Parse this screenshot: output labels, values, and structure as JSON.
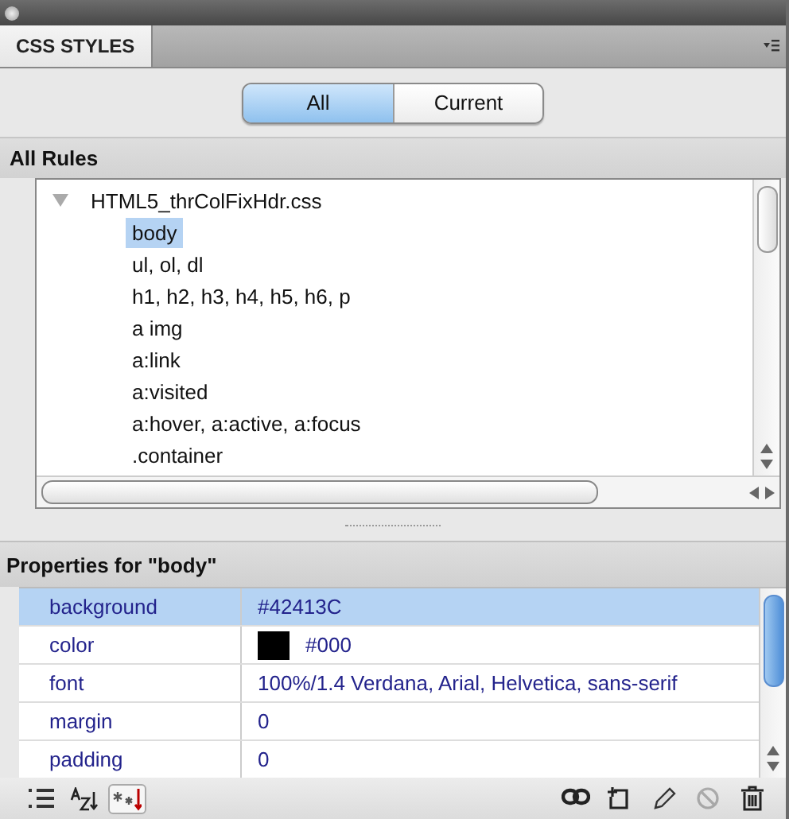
{
  "panel_tab": {
    "label": "CSS STYLES",
    "selected": true
  },
  "mode_buttons": [
    {
      "label": "All",
      "selected": true
    },
    {
      "label": "Current",
      "selected": false
    }
  ],
  "rules_header": "All Rules",
  "rules_tree": [
    {
      "label": "HTML5_thrColFixHdr.css",
      "expanded": true,
      "selected": false,
      "children": [
        {
          "label": "body",
          "selected": true
        },
        {
          "label": "ul, ol, dl",
          "selected": false
        },
        {
          "label": "h1, h2, h3, h4, h5, h6, p",
          "selected": false
        },
        {
          "label": "a img",
          "selected": false
        },
        {
          "label": "a:link",
          "selected": false
        },
        {
          "label": "a:visited",
          "selected": false
        },
        {
          "label": "a:hover, a:active, a:focus",
          "selected": false
        },
        {
          "label": ".container",
          "selected": false
        }
      ]
    }
  ],
  "properties_header": "Properties for \"body\"",
  "properties": [
    {
      "name": "background",
      "value": "#42413C",
      "selected": true
    },
    {
      "name": "color",
      "value": "#000",
      "color": "#000000",
      "selected": false
    },
    {
      "name": "font",
      "value": "100%/1.4 Verdana, Arial, Helvetica, sans-serif",
      "selected": false
    },
    {
      "name": "margin",
      "value": "0",
      "selected": false
    },
    {
      "name": "padding",
      "value": "0",
      "selected": false
    }
  ],
  "view_buttons": [
    {
      "kind": "category",
      "selected": false
    },
    {
      "kind": "alphabetical",
      "selected": false
    },
    {
      "kind": "set-only",
      "selected": true
    }
  ],
  "actions": [
    {
      "kind": "attach",
      "disabled": false
    },
    {
      "kind": "new-rule",
      "disabled": false
    },
    {
      "kind": "edit",
      "disabled": false
    },
    {
      "kind": "disable",
      "disabled": true
    },
    {
      "kind": "delete",
      "disabled": false
    }
  ]
}
